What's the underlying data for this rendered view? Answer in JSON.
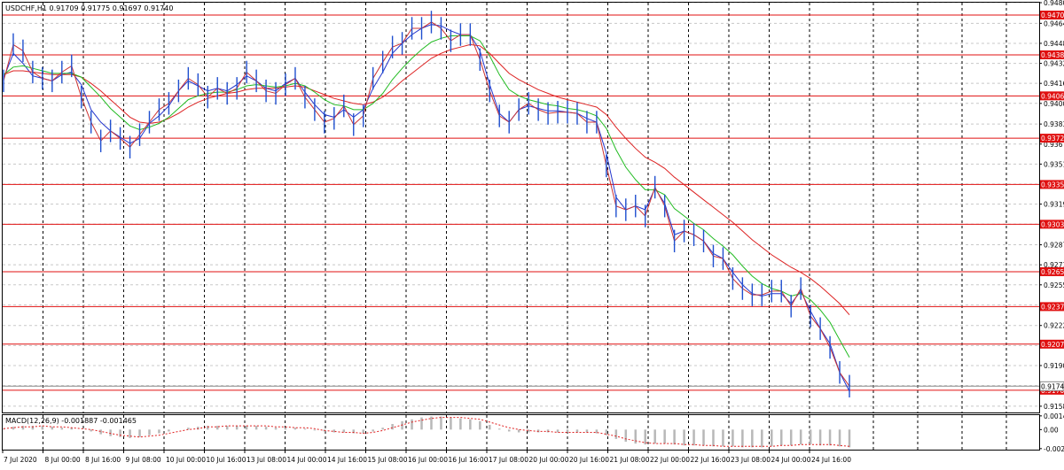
{
  "chart_data": {
    "type": "line",
    "title": "USDCHF,H1  0.91709 0.91775 0.91697 0.91740",
    "ylim": [
      0.9153,
      0.94805
    ],
    "y_ticks": [
      "0.94805",
      "0.94640",
      "0.94480",
      "0.94320",
      "0.94160",
      "0.94000",
      "0.93835",
      "0.93675",
      "0.93515",
      "0.93355",
      "0.93195",
      "0.93035",
      "0.92870",
      "0.92710",
      "0.92550",
      "0.92390",
      "0.92225",
      "0.92065",
      "0.91905",
      "0.91745",
      "0.91580"
    ],
    "x_ticks": [
      "7 Jul 2020",
      "8 Jul 00:00",
      "8 Jul 16:00",
      "9 Jul 08:00",
      "10 Jul 00:00",
      "10 Jul 16:00",
      "13 Jul 08:00",
      "14 Jul 00:00",
      "14 Jul 16:00",
      "15 Jul 08:00",
      "16 Jul 00:00",
      "16 Jul 16:00",
      "17 Jul 08:00",
      "20 Jul 00:00",
      "20 Jul 16:00",
      "21 Jul 08:00",
      "22 Jul 00:00",
      "22 Jul 16:00",
      "23 Jul 08:00",
      "24 Jul 00:00",
      "24 Jul 16:00"
    ],
    "price_levels": [
      {
        "label": "0.94706",
        "value": 0.94706
      },
      {
        "label": "0.94388",
        "value": 0.94388
      },
      {
        "label": "0.94060",
        "value": 0.9406
      },
      {
        "label": "0.93722",
        "value": 0.93722
      },
      {
        "label": "0.93352",
        "value": 0.93352
      },
      {
        "label": "0.93034",
        "value": 0.93034
      },
      {
        "label": "0.92655",
        "value": 0.92655
      },
      {
        "label": "0.92376",
        "value": 0.92376
      },
      {
        "label": "0.92076",
        "value": 0.92076
      },
      {
        "label": "0.91708",
        "value": 0.91708
      }
    ],
    "current_price": {
      "label": "0.91740",
      "value": 0.9174
    },
    "series": [
      {
        "color": "#2233cc",
        "values": [
          0.942,
          0.944,
          0.9432,
          0.9422,
          0.942,
          0.9418,
          0.9423,
          0.9425,
          0.9415,
          0.9395,
          0.9385,
          0.9378,
          0.9373,
          0.9368,
          0.9372,
          0.9384,
          0.939,
          0.9398,
          0.941,
          0.9418,
          0.9414,
          0.941,
          0.9412,
          0.941,
          0.9415,
          0.9422,
          0.9418,
          0.9412,
          0.941,
          0.9416,
          0.942,
          0.9409,
          0.9399,
          0.9391,
          0.9389,
          0.9395,
          0.9389,
          0.9395,
          0.9412,
          0.9425,
          0.944,
          0.9448,
          0.9455,
          0.946,
          0.9463,
          0.9462,
          0.9458,
          0.9455,
          0.9455,
          0.9442,
          0.9415,
          0.9392,
          0.9385,
          0.9395,
          0.9398,
          0.9396,
          0.9394,
          0.9394,
          0.9393,
          0.9392,
          0.9388,
          0.9385,
          0.936,
          0.9325,
          0.9315,
          0.9318,
          0.9315,
          0.9332,
          0.932,
          0.9295,
          0.9298,
          0.9295,
          0.929,
          0.928,
          0.9276,
          0.9265,
          0.9255,
          0.9248,
          0.9246,
          0.9248,
          0.9248,
          0.924,
          0.925,
          0.9234,
          0.922,
          0.9208,
          0.9185,
          0.917
        ]
      },
      {
        "color": "#dd2222",
        "values": [
          0.9423,
          0.9426,
          0.9426,
          0.9425,
          0.9424,
          0.9423,
          0.9423,
          0.9423,
          0.9421,
          0.9416,
          0.941,
          0.9403,
          0.9396,
          0.9389,
          0.9385,
          0.9384,
          0.9385,
          0.9388,
          0.9392,
          0.9397,
          0.9401,
          0.9404,
          0.9406,
          0.9408,
          0.9409,
          0.9411,
          0.9412,
          0.9412,
          0.9412,
          0.9413,
          0.9414,
          0.9413,
          0.941,
          0.9407,
          0.9404,
          0.9402,
          0.94,
          0.9399,
          0.9401,
          0.9405,
          0.9411,
          0.9418,
          0.9424,
          0.943,
          0.9436,
          0.944,
          0.9443,
          0.9445,
          0.9447,
          0.9446,
          0.944,
          0.9432,
          0.9424,
          0.9419,
          0.9415,
          0.9411,
          0.9408,
          0.9405,
          0.9403,
          0.9401,
          0.9399,
          0.9397,
          0.9391,
          0.9381,
          0.9372,
          0.9364,
          0.9357,
          0.9353,
          0.9348,
          0.9341,
          0.9335,
          0.9329,
          0.9323,
          0.9317,
          0.9311,
          0.9305,
          0.9298,
          0.9291,
          0.9285,
          0.9279,
          0.9274,
          0.9269,
          0.9265,
          0.926,
          0.9254,
          0.9247,
          0.924,
          0.9231
        ]
      },
      {
        "color": "#22bb22",
        "values": [
          0.9423,
          0.9429,
          0.943,
          0.9428,
          0.9426,
          0.9424,
          0.9424,
          0.9424,
          0.9421,
          0.9413,
          0.9405,
          0.9396,
          0.9389,
          0.9382,
          0.9379,
          0.9381,
          0.9384,
          0.9389,
          0.9396,
          0.9403,
          0.9406,
          0.9408,
          0.9409,
          0.9409,
          0.9411,
          0.9414,
          0.9415,
          0.9414,
          0.9413,
          0.9414,
          0.9416,
          0.9414,
          0.9409,
          0.9403,
          0.9399,
          0.9398,
          0.9395,
          0.9395,
          0.94,
          0.9408,
          0.9419,
          0.9428,
          0.9436,
          0.9443,
          0.9449,
          0.9452,
          0.9454,
          0.9454,
          0.9454,
          0.945,
          0.9438,
          0.9423,
          0.9411,
          0.9406,
          0.9403,
          0.9401,
          0.9399,
          0.9398,
          0.9396,
          0.9395,
          0.9393,
          0.939,
          0.938,
          0.9363,
          0.9349,
          0.9339,
          0.9331,
          0.9331,
          0.9327,
          0.9316,
          0.931,
          0.9304,
          0.9299,
          0.9292,
          0.9286,
          0.9279,
          0.927,
          0.9262,
          0.9256,
          0.9252,
          0.925,
          0.9246,
          0.9248,
          0.9243,
          0.9235,
          0.9225,
          0.9211,
          0.9197
        ]
      },
      {
        "color": "#cc3333",
        "values": [
          0.9418,
          0.9447,
          0.9442,
          0.9425,
          0.942,
          0.9418,
          0.9425,
          0.943,
          0.9405,
          0.9385,
          0.937,
          0.9378,
          0.9372,
          0.9365,
          0.9375,
          0.9385,
          0.9395,
          0.94,
          0.941,
          0.942,
          0.9415,
          0.9405,
          0.9412,
          0.9408,
          0.9412,
          0.9425,
          0.9418,
          0.941,
          0.9408,
          0.9415,
          0.942,
          0.9405,
          0.9395,
          0.9385,
          0.9388,
          0.9398,
          0.9383,
          0.939,
          0.942,
          0.9433,
          0.9445,
          0.9448,
          0.946,
          0.946,
          0.9465,
          0.946,
          0.945,
          0.9455,
          0.9455,
          0.9435,
          0.941,
          0.939,
          0.9385,
          0.9395,
          0.94,
          0.9395,
          0.9392,
          0.9393,
          0.9393,
          0.9392,
          0.9385,
          0.9385,
          0.935,
          0.9318,
          0.9315,
          0.9318,
          0.931,
          0.9333,
          0.9318,
          0.929,
          0.9298,
          0.9295,
          0.929,
          0.9278,
          0.9276,
          0.926,
          0.9252,
          0.9247,
          0.9247,
          0.925,
          0.925,
          0.9238,
          0.9252,
          0.923,
          0.922,
          0.9205,
          0.9185,
          0.9174
        ]
      }
    ],
    "macd": {
      "label": "MACD(12,26,9) -0.001887 -0.001465",
      "y_ticks": [
        "0.001469",
        "0.00",
        "-0.00204"
      ],
      "ylim": [
        -0.00215,
        0.00155
      ],
      "histogram": [
        0.0001,
        0.0003,
        0.0004,
        0.0004,
        0.0004,
        0.0003,
        0.0002,
        0.0002,
        0.0,
        -0.0002,
        -0.0005,
        -0.0007,
        -0.0008,
        -0.0009,
        -0.0008,
        -0.0006,
        -0.0004,
        -0.0002,
        0.0,
        0.0002,
        0.0003,
        0.0004,
        0.0004,
        0.0004,
        0.0004,
        0.0004,
        0.0004,
        0.0003,
        0.0002,
        0.0002,
        0.0002,
        0.0001,
        -0.0001,
        -0.0002,
        -0.0003,
        -0.0003,
        -0.0004,
        -0.0004,
        -0.0002,
        0.0002,
        0.0006,
        0.0009,
        0.0011,
        0.0013,
        0.0014,
        0.0014,
        0.0013,
        0.0012,
        0.0011,
        0.0009,
        0.0005,
        0.0001,
        -0.0002,
        -0.0003,
        -0.0003,
        -0.0003,
        -0.0003,
        -0.0003,
        -0.0003,
        -0.0003,
        -0.0003,
        -0.0004,
        -0.0006,
        -0.001,
        -0.0013,
        -0.0015,
        -0.0016,
        -0.0015,
        -0.0015,
        -0.0016,
        -0.0017,
        -0.0017,
        -0.0017,
        -0.0018,
        -0.0018,
        -0.0018,
        -0.0019,
        -0.0019,
        -0.0019,
        -0.0018,
        -0.0017,
        -0.0017,
        -0.0016,
        -0.0016,
        -0.0017,
        -0.0017,
        -0.0018,
        -0.0019
      ],
      "signal": [
        0.0001,
        0.0002,
        0.0003,
        0.0003,
        0.0004,
        0.0003,
        0.0003,
        0.0002,
        0.0001,
        0.0,
        -0.0002,
        -0.0004,
        -0.0006,
        -0.0007,
        -0.0008,
        -0.0007,
        -0.0006,
        -0.0004,
        -0.0002,
        0.0,
        0.0001,
        0.0003,
        0.0003,
        0.0004,
        0.0004,
        0.0004,
        0.0004,
        0.0004,
        0.0003,
        0.0003,
        0.0002,
        0.0002,
        0.0001,
        -0.0001,
        -0.0002,
        -0.0003,
        -0.0003,
        -0.0004,
        -0.0003,
        -0.0001,
        0.0002,
        0.0005,
        0.0008,
        0.001,
        0.0012,
        0.0013,
        0.0013,
        0.0013,
        0.0012,
        0.0011,
        0.0008,
        0.0005,
        0.0002,
        0.0,
        -0.0001,
        -0.0002,
        -0.0002,
        -0.0003,
        -0.0003,
        -0.0003,
        -0.0003,
        -0.0003,
        -0.0005,
        -0.0007,
        -0.001,
        -0.0012,
        -0.0014,
        -0.0015,
        -0.0015,
        -0.0015,
        -0.0016,
        -0.0016,
        -0.0017,
        -0.0017,
        -0.0018,
        -0.0018,
        -0.0018,
        -0.0018,
        -0.0018,
        -0.0018,
        -0.0017,
        -0.0017,
        -0.0016,
        -0.0016,
        -0.0016,
        -0.0016,
        -0.0017,
        -0.0018
      ]
    }
  }
}
